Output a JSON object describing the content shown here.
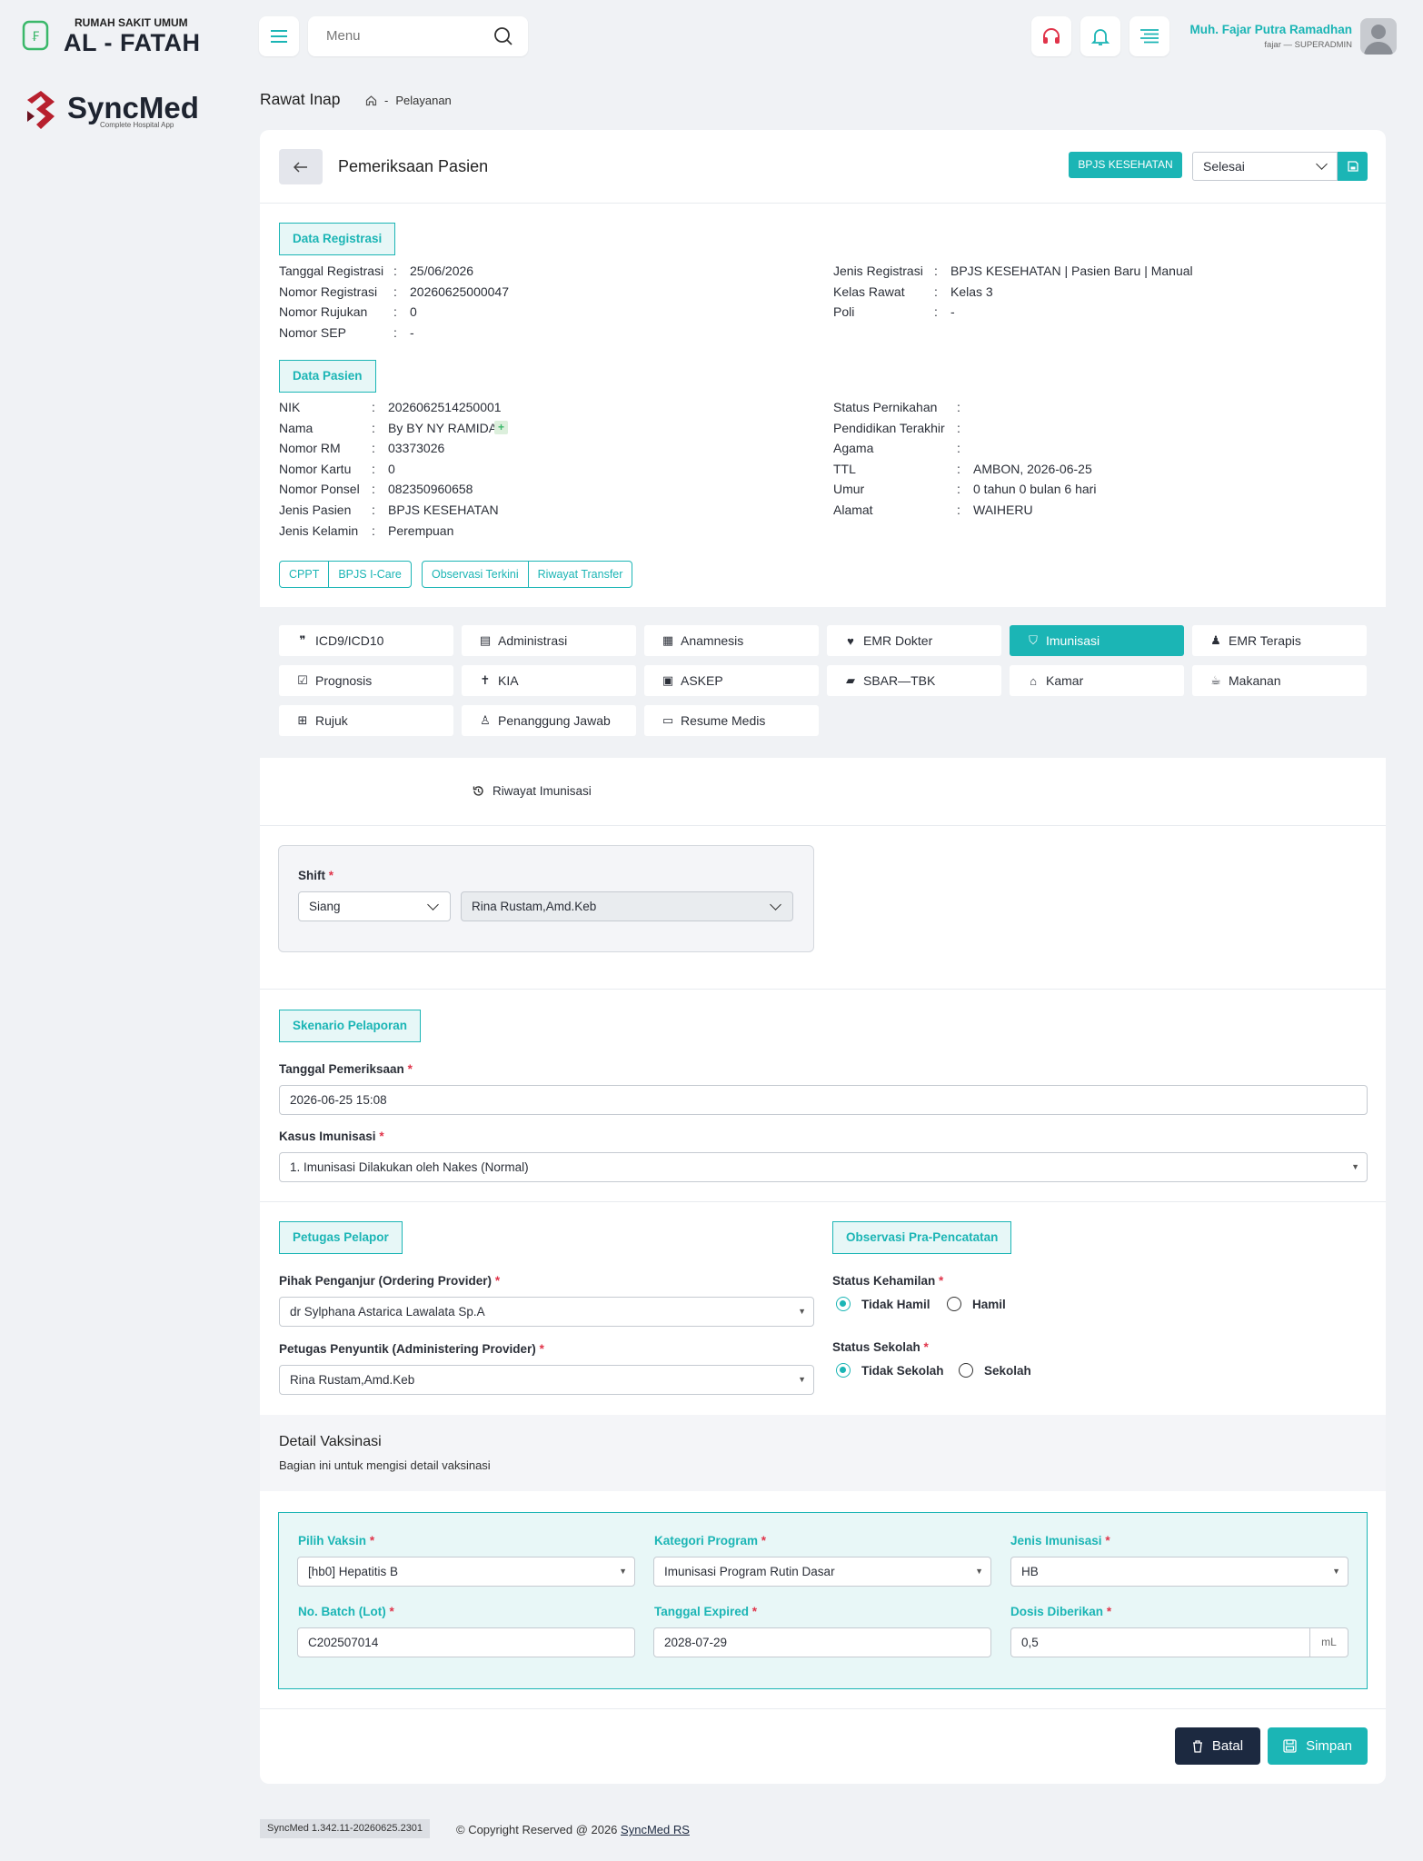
{
  "hospital": {
    "line1": "RUMAH SAKIT UMUM",
    "line2": "AL - FATAH"
  },
  "brand": {
    "name": "SyncMed",
    "tagline": "Complete Hospital App"
  },
  "header": {
    "search_placeholder": "Menu",
    "user_name": "Muh. Fajar Putra Ramadhan",
    "user_role": "fajar — SUPERADMIN"
  },
  "page": {
    "title": "Rawat Inap",
    "breadcrumb": "Pelayanan"
  },
  "card": {
    "title": "Pemeriksaan Pasien",
    "insurance_badge": "BPJS KESEHATAN",
    "status_select": "Selesai"
  },
  "registrasi": {
    "heading": "Data Registrasi",
    "left": [
      {
        "k": "Tanggal Registrasi",
        "v": "25/06/2026"
      },
      {
        "k": "Nomor Registrasi",
        "v": "20260625000047"
      },
      {
        "k": "Nomor Rujukan",
        "v": "0"
      },
      {
        "k": "Nomor SEP",
        "v": "-"
      }
    ],
    "right": [
      {
        "k": "Jenis Registrasi",
        "v": "BPJS KESEHATAN | Pasien Baru | Manual"
      },
      {
        "k": "Kelas Rawat",
        "v": "Kelas 3"
      },
      {
        "k": "Poli",
        "v": "-"
      }
    ]
  },
  "pasien": {
    "heading": "Data Pasien",
    "left": [
      {
        "k": "NIK",
        "v": "2026062514250001"
      },
      {
        "k": "Nama",
        "v": "By BY NY RAMIDA"
      },
      {
        "k": "Nomor RM",
        "v": "03373026"
      },
      {
        "k": "Nomor Kartu",
        "v": "0"
      },
      {
        "k": "Nomor Ponsel",
        "v": "082350960658"
      },
      {
        "k": "Jenis Pasien",
        "v": "BPJS KESEHATAN"
      },
      {
        "k": "Jenis Kelamin",
        "v": "Perempuan"
      }
    ],
    "right": [
      {
        "k": "Status Pernikahan",
        "v": ""
      },
      {
        "k": "Pendidikan Terakhir",
        "v": ""
      },
      {
        "k": "Agama",
        "v": ""
      },
      {
        "k": "TTL",
        "v": "AMBON, 2026-06-25"
      },
      {
        "k": "Umur",
        "v": "0 tahun 0 bulan 6 hari"
      },
      {
        "k": "Alamat",
        "v": "WAIHERU"
      }
    ]
  },
  "quick_buttons": {
    "group1": [
      "CPPT",
      "BPJS I-Care"
    ],
    "group2": [
      "Observasi Terkini",
      "Riwayat Transfer"
    ]
  },
  "tabs": [
    {
      "label": "ICD9/ICD10",
      "icon": "❞"
    },
    {
      "label": "Administrasi",
      "icon": "▤"
    },
    {
      "label": "Anamnesis",
      "icon": "▦"
    },
    {
      "label": "EMR Dokter",
      "icon": "♥"
    },
    {
      "label": "Imunisasi",
      "icon": "⛉"
    },
    {
      "label": "EMR Terapis",
      "icon": "♟"
    },
    {
      "label": "Prognosis",
      "icon": "☑"
    },
    {
      "label": "KIA",
      "icon": "✝"
    },
    {
      "label": "ASKEP",
      "icon": "▣"
    },
    {
      "label": "SBAR—TBK",
      "icon": "▰"
    },
    {
      "label": "Kamar",
      "icon": "⌂"
    },
    {
      "label": "Makanan",
      "icon": "☕"
    },
    {
      "label": "Rujuk",
      "icon": "⊞"
    },
    {
      "label": "Penanggung Jawab",
      "icon": "♙"
    },
    {
      "label": "Resume Medis",
      "icon": "▭"
    }
  ],
  "riwayat_link": "Riwayat Imunisasi",
  "shift": {
    "label": "Shift",
    "value": "Siang",
    "nurse": "Rina Rustam,Amd.Keb"
  },
  "skenario": {
    "heading": "Skenario Pelaporan",
    "tgl_label": "Tanggal Pemeriksaan",
    "tgl_value": "2026-06-25 15:08",
    "kasus_label": "Kasus Imunisasi",
    "kasus_value": "1. Imunisasi Dilakukan oleh Nakes (Normal)"
  },
  "petugas": {
    "heading": "Petugas Pelapor",
    "ordering_label": "Pihak Penganjur (Ordering Provider)",
    "ordering_value": "dr Sylphana Astarica Lawalata Sp.A",
    "admin_label": "Petugas Penyuntik (Administering Provider)",
    "admin_value": "Rina Rustam,Amd.Keb"
  },
  "observasi": {
    "heading": "Observasi Pra-Pencatatan",
    "kehamilan_label": "Status Kehamilan",
    "kehamilan_opt1": "Tidak Hamil",
    "kehamilan_opt2": "Hamil",
    "sekolah_label": "Status Sekolah",
    "sekolah_opt1": "Tidak Sekolah",
    "sekolah_opt2": "Sekolah"
  },
  "vaksin": {
    "title": "Detail Vaksinasi",
    "subtitle": "Bagian ini untuk mengisi detail vaksinasi",
    "pilih_label": "Pilih Vaksin",
    "pilih_value": "[hb0] Hepatitis B",
    "kategori_label": "Kategori Program",
    "kategori_value": "Imunisasi Program Rutin Dasar",
    "jenis_label": "Jenis Imunisasi",
    "jenis_value": "HB",
    "batch_label": "No. Batch (Lot)",
    "batch_value": "C202507014",
    "expired_label": "Tanggal Expired",
    "expired_value": "2028-07-29",
    "dosis_label": "Dosis Diberikan",
    "dosis_value": "0,5",
    "dosis_unit": "mL"
  },
  "actions": {
    "cancel": "Batal",
    "save": "Simpan"
  },
  "footer": {
    "version": "SyncMed 1.342.11-20260625.2301",
    "copyright": "© Copyright Reserved @ 2026",
    "link": "SyncMed RS"
  },
  "colors": {
    "accent": "#1bb5b5",
    "brand_red": "#b8202e",
    "dark_button": "#1c2940"
  }
}
